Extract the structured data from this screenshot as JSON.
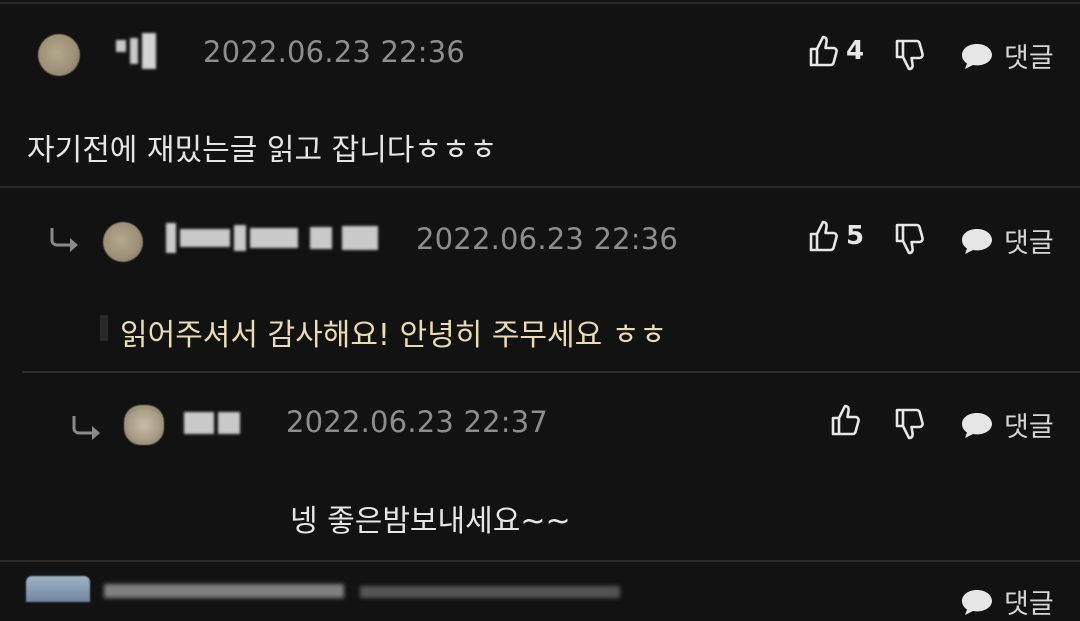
{
  "comments": [
    {
      "timestamp": "2022.06.23 22:36",
      "like_count": "4",
      "reply_label": "댓글",
      "text": "자기전에 재밌는글 읽고 잡니다ㅎㅎㅎ",
      "text_color": "#e6e6e6"
    },
    {
      "timestamp": "2022.06.23 22:36",
      "like_count": "5",
      "reply_label": "댓글",
      "text": "읽어주셔서 감사해요! 안녕히 주무세요 ㅎㅎ",
      "text_color": "#e8dcb0"
    },
    {
      "timestamp": "2022.06.23 22:37",
      "like_count": "",
      "reply_label": "댓글",
      "text": "넹 좋은밤보내세요~~",
      "text_color": "#e6e6e6"
    }
  ],
  "footer_preview": {
    "reply_label": "댓글"
  },
  "icons": {
    "like": "thumbs-up-icon",
    "dislike": "thumbs-down-icon",
    "reply": "speech-bubble-icon",
    "nested_reply": "reply-arrow-icon"
  },
  "colors": {
    "background": "#121212",
    "divider": "#2b2b2b",
    "timestamp": "#8d8d8d",
    "author_reply_text": "#e8dcb0"
  }
}
